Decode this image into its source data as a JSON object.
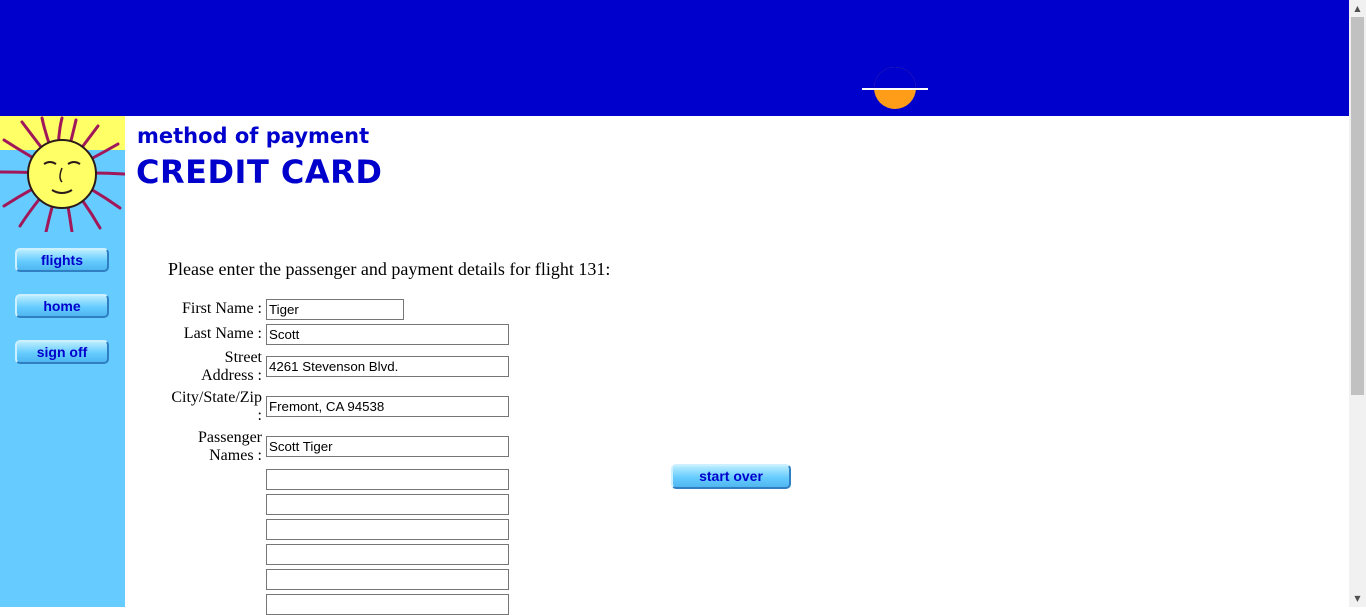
{
  "sidebar": {
    "nav": [
      {
        "label": "flights"
      },
      {
        "label": "home"
      },
      {
        "label": "sign off"
      }
    ]
  },
  "header": {
    "subtitle": "method of payment",
    "title": "CREDIT CARD"
  },
  "form": {
    "intro": "Please enter the passenger and payment details for flight 131:",
    "first_name": {
      "label": "First Name :",
      "value": "Tiger"
    },
    "last_name": {
      "label": "Last Name :",
      "value": "Scott"
    },
    "street": {
      "label_line1": "Street",
      "label_line2": "Address :",
      "value": "4261 Stevenson Blvd."
    },
    "city": {
      "label_line1": "City/State/Zip",
      "label_line2": ":",
      "value": "Fremont, CA 94538"
    },
    "passengers": {
      "label_line1": "Passenger",
      "label_line2": "Names :",
      "values": [
        "Scott Tiger",
        "",
        "",
        "",
        "",
        "",
        ""
      ]
    },
    "start_over_label": "start over"
  },
  "colors": {
    "banner": "#0000cc",
    "sidebar": "#66ccff",
    "heading": "#0000cc",
    "sun": "#ff9c18",
    "logo_sun": "#ffff66"
  },
  "icons": {
    "logo": "sun-face-icon",
    "scroll_up": "arrow-up-icon",
    "scroll_down": "arrow-down-icon"
  }
}
